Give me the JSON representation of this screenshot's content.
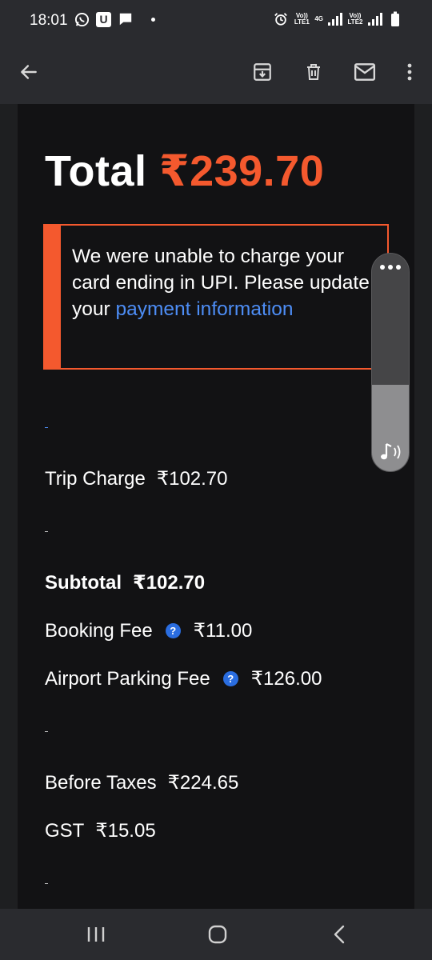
{
  "status_bar": {
    "time": "18:01",
    "u_badge": "U",
    "sim1_label": "Vo)) LTE1",
    "network_label": "4G",
    "sim2_label": "Vo)) LTE2"
  },
  "app_bar": {
    "icons": [
      "back-arrow-icon",
      "archive-icon",
      "delete-icon",
      "mail-icon",
      "more-vert-icon"
    ]
  },
  "receipt": {
    "total_label": "Total",
    "total_amount": "₹239.70",
    "alert": {
      "text": "We were unable to charge your card ending in UPI. Please update your ",
      "link_text": "payment information"
    },
    "trip_charge_label": "Trip Charge",
    "trip_charge_value": "₹102.70",
    "subtotal_label": "Subtotal",
    "subtotal_value": "₹102.70",
    "booking_fee_label": "Booking Fee",
    "booking_fee_value": "₹11.00",
    "airport_fee_label": "Airport Parking Fee",
    "airport_fee_value": "₹126.00",
    "before_taxes_label": "Before Taxes",
    "before_taxes_value": "₹224.65",
    "gst_label": "GST",
    "gst_value": "₹15.05",
    "help_glyph": "?"
  },
  "colors": {
    "accent": "#f4592e",
    "link": "#4d8df5",
    "background": "#121214",
    "bar": "#2a2b2f"
  }
}
